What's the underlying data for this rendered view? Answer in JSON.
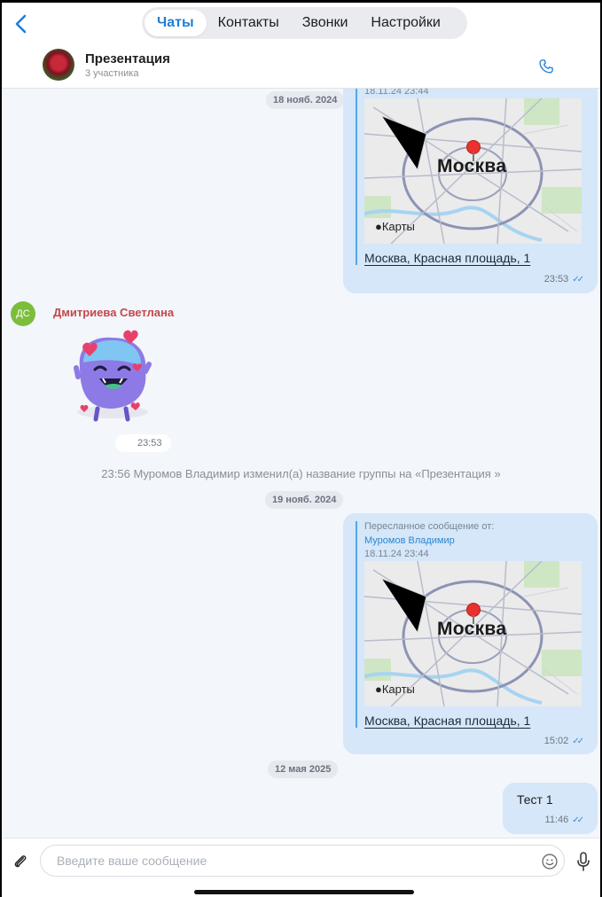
{
  "nav": {
    "tabs": [
      {
        "label": "Чаты",
        "active": true
      },
      {
        "label": "Контакты",
        "active": false
      },
      {
        "label": "Звонки",
        "active": false
      },
      {
        "label": "Настройки",
        "active": false
      }
    ]
  },
  "chat": {
    "title": "Презентация",
    "subtitle": "3 участника"
  },
  "messages": {
    "date1": "18 нояб. 2024",
    "loc1": {
      "fwd_date": "18.11.24 23:44",
      "city": "Москва",
      "brand": "Карты",
      "address": "Москва, Красная площадь, 1",
      "time": "23:53"
    },
    "sender_initials": "ДС",
    "sender_name": "Дмитриева Светлана",
    "sticker_time": "23:53",
    "system": "23:56  Муромов Владимир изменил(а) название группы на «Презентация »",
    "date2": "19 нояб. 2024",
    "loc2": {
      "fwd_label": "Пересланное сообщение от:",
      "fwd_from": "Муромов Владимир",
      "fwd_date": "18.11.24 23:44",
      "city": "Москва",
      "brand": "Карты",
      "address": "Москва, Красная площадь, 1",
      "time": "15:02"
    },
    "date3": "12 мая 2025",
    "text_msg": {
      "text": "Тест 1",
      "time": "11:46"
    }
  },
  "composer": {
    "placeholder": "Введите ваше сообщение"
  },
  "colors": {
    "accent": "#1f7fd9",
    "bubble_out": "#d5e7f8",
    "sender_name": "#c4474b",
    "avatar_green": "#7cbd3c"
  }
}
